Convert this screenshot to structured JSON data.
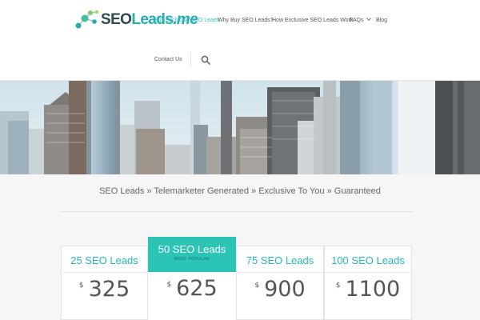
{
  "brand": {
    "logo_text_dark": "SEO",
    "logo_text_teal": "Leads",
    "logo_text_suffix": ".me"
  },
  "nav": {
    "items": [
      {
        "label": "Buy Exclusive SEO Leads"
      },
      {
        "label": "Why Buy SEO Leads?"
      },
      {
        "label": "How Exclusive SEO Leads Work"
      },
      {
        "label": "FAQs"
      },
      {
        "label": "Blog"
      }
    ],
    "contact_label": "Contact Us",
    "search_icon": "search-icon"
  },
  "tagline": "SEO Leads » Telemarketer Generated » Exclusive To You » Guaranteed",
  "pricing": {
    "plans": [
      {
        "title": "25 SEO Leads",
        "currency": "$",
        "price": "325"
      },
      {
        "title": "50 SEO Leads",
        "subtitle": "MOST POPULAR",
        "currency": "$",
        "price": "625"
      },
      {
        "title": "75 SEO Leads",
        "currency": "$",
        "price": "900"
      },
      {
        "title": "100 SEO Leads",
        "currency": "$",
        "price": "1100"
      }
    ]
  },
  "colors": {
    "accent": "#2cc4b4",
    "brand_teal": "#27aab0",
    "background": "#f6f6f6"
  }
}
